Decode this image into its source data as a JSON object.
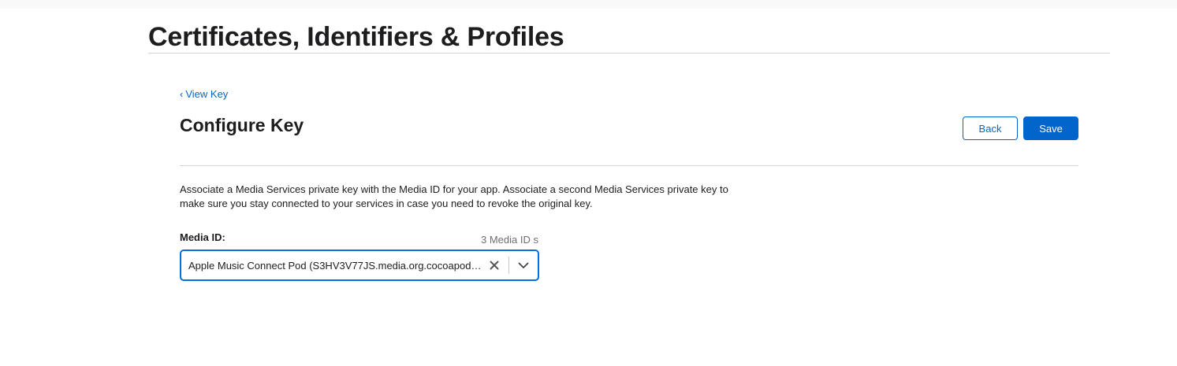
{
  "header": {
    "title": "Certificates, Identifiers & Profiles"
  },
  "nav": {
    "back_link_chevron": "‹",
    "back_link_label": "View Key"
  },
  "section": {
    "title": "Configure Key",
    "back_button": "Back",
    "save_button": "Save"
  },
  "description": "Associate a Media Services private key with the Media ID for your app. Associate a second Media Services private key to make sure you stay connected to your services in case you need to revoke the original key.",
  "media_field": {
    "label": "Media ID:",
    "count": "3 Media ID s",
    "selected_value": "Apple Music Connect Pod (S3HV3V77JS.media.org.cocoapods.AppleMusicConnectPod)"
  },
  "colors": {
    "accent": "#0066cc",
    "focus": "#0071e3"
  },
  "icons": {
    "clear": "close-icon",
    "dropdown": "chevron-down-icon"
  }
}
